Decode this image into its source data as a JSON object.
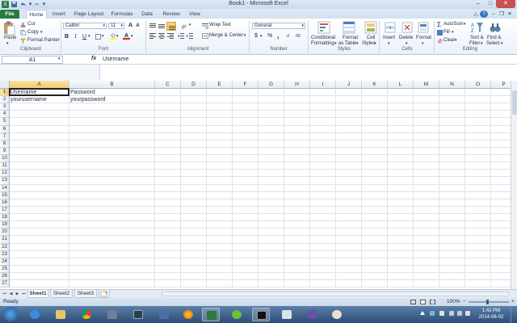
{
  "window": {
    "title": "Book1 - Microsoft Excel",
    "min_glyph": "–",
    "max_glyph": "□",
    "close_glyph": "✕",
    "ribbon_min_glyph": "△",
    "help_glyph": "?",
    "doc_min_glyph": "–",
    "doc_restore_glyph": "❐",
    "doc_close_glyph": "✕"
  },
  "quick_access": {
    "save_icon": "disk-icon",
    "undo_icon": "undo-icon",
    "redo_icon": "redo-icon",
    "app_icon": "excel-icon"
  },
  "tabs": [
    "File",
    "Home",
    "Insert",
    "Page Layout",
    "Formulas",
    "Data",
    "Review",
    "View"
  ],
  "ribbon": {
    "clipboard": {
      "label": "Clipboard",
      "paste": "Paste",
      "cut": "Cut",
      "copy": "Copy",
      "copy_arrow": "▾",
      "format_painter": "Format Painter"
    },
    "font": {
      "label": "Font",
      "font_name": "Calibri",
      "font_size": "11",
      "grow": "A",
      "shrink": "A",
      "bold": "B",
      "italic": "I",
      "underline": "U",
      "font_color_letter": "A"
    },
    "alignment": {
      "label": "Alignment",
      "wrap_text": "Wrap Text",
      "merge_center": "Merge & Center",
      "merge_arrow": "▾"
    },
    "number": {
      "label": "Number",
      "format": "General",
      "currency": "$",
      "currency_arrow": "▾",
      "percent": "%",
      "comma": ",",
      "inc_decimal": ".0",
      "dec_decimal": ".00"
    },
    "styles": {
      "label": "Styles",
      "conditional_1": "Conditional",
      "conditional_2": "Formatting",
      "conditional_arrow": "▾",
      "format_table_1": "Format",
      "format_table_2": "as Table",
      "format_table_arrow": "▾",
      "cell_styles_1": "Cell",
      "cell_styles_2": "Styles",
      "cell_styles_arrow": "▾"
    },
    "cells": {
      "label": "Cells",
      "insert": "Insert",
      "insert_arrow": "▾",
      "delete": "Delete",
      "delete_arrow": "▾",
      "format": "Format",
      "format_arrow": "▾"
    },
    "editing": {
      "label": "Editing",
      "autosum": "AutoSum",
      "autosum_arrow": "▾",
      "fill": "Fill",
      "fill_arrow": "▾",
      "clear": "Clear",
      "clear_arrow": "▾",
      "sort_1": "Sort &",
      "sort_2": "Filter",
      "sort_arrow": "▾",
      "find_1": "Find &",
      "find_2": "Select",
      "find_arrow": "▾"
    },
    "dropdown_arrow": "▾"
  },
  "formula_bar": {
    "name_box": "A1",
    "fx": "fx",
    "content": "Username"
  },
  "grid": {
    "columns": [
      "A",
      "B",
      "C",
      "D",
      "E",
      "F",
      "G",
      "H",
      "I",
      "J",
      "K",
      "L",
      "M",
      "N",
      "O",
      "P",
      "Q"
    ],
    "rows": [
      1,
      2,
      3,
      4,
      5,
      6,
      7,
      8,
      9,
      10,
      11,
      12,
      13,
      14,
      15,
      16,
      17,
      18,
      19,
      20,
      21,
      22,
      23,
      24,
      25,
      26,
      27
    ],
    "cells": {
      "A1": "Username",
      "B1": "Password",
      "A2": "yourusername",
      "B2": "yourpassword"
    },
    "selected_cell": "A1"
  },
  "sheets": {
    "tabs": [
      "Sheet1",
      "Sheet2",
      "Sheet3"
    ],
    "active": "Sheet1",
    "nav": [
      "⏮",
      "◀",
      "▶",
      "⏭"
    ]
  },
  "status_bar": {
    "ready": "Ready",
    "zoom": "100%",
    "zoom_minus": "−",
    "zoom_plus": "+"
  },
  "taskbar": {
    "apps": [
      "start-orb",
      "internet-explorer",
      "file-explorer",
      "chrome",
      "computer",
      "vpn-monitor",
      "firefox",
      "excel",
      "xbox",
      "cmd",
      "media",
      "paint"
    ],
    "time": "1:42 PM",
    "date": "2014-06-02"
  },
  "colors": {
    "file_tab": "#2b7a3f",
    "selection_header": "#f4c96e",
    "close_button": "#c75050",
    "taskbar": "#2c4d75"
  }
}
